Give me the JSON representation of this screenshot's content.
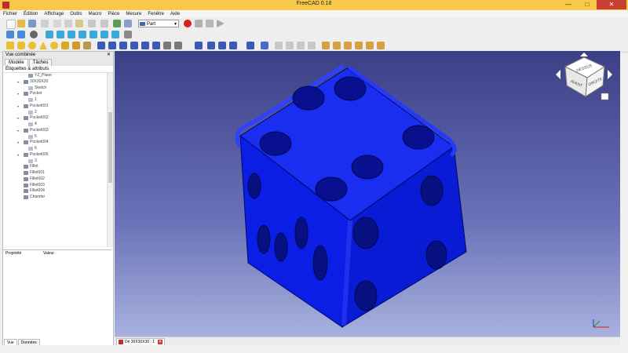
{
  "window": {
    "title": "FreeCAD 0.18",
    "min": "—",
    "max": "□",
    "close": "✕"
  },
  "menu": [
    "Fichier",
    "Édition",
    "Affichage",
    "Outils",
    "Macro",
    "Pièce",
    "Mesure",
    "Fenêtre",
    "Aide"
  ],
  "workbench": {
    "selected": "Part",
    "arrow": "▼"
  },
  "combo_view": {
    "title": "Vue combinée",
    "close": "✕",
    "tabs": [
      "Modèle",
      "Tâches"
    ],
    "tree_header": "Étiquettes & attributs",
    "tree": [
      {
        "label": "YZ_Plane",
        "level": 3,
        "icon": "plane"
      },
      {
        "label": "30X30X30",
        "level": 2,
        "icon": "body",
        "exp": "▾"
      },
      {
        "label": "Sketch",
        "level": 3,
        "icon": "sketch"
      },
      {
        "label": "Pocket",
        "level": 2,
        "icon": "feature",
        "exp": "▾"
      },
      {
        "label": "1",
        "level": 3,
        "icon": "sketch"
      },
      {
        "label": "Pocket001",
        "level": 2,
        "icon": "feature",
        "exp": "▾"
      },
      {
        "label": "2",
        "level": 3,
        "icon": "sketch"
      },
      {
        "label": "Pocket002",
        "level": 2,
        "icon": "feature",
        "exp": "▾"
      },
      {
        "label": "4",
        "level": 3,
        "icon": "sketch"
      },
      {
        "label": "Pocket003",
        "level": 2,
        "icon": "feature",
        "exp": "▾"
      },
      {
        "label": "5",
        "level": 3,
        "icon": "sketch"
      },
      {
        "label": "Pocket004",
        "level": 2,
        "icon": "feature",
        "exp": "▾"
      },
      {
        "label": "6",
        "level": 3,
        "icon": "sketch"
      },
      {
        "label": "Pocket005",
        "level": 2,
        "icon": "feature",
        "exp": "▾"
      },
      {
        "label": "3",
        "level": 3,
        "icon": "sketch"
      },
      {
        "label": "Fillet",
        "level": 2,
        "icon": "feature"
      },
      {
        "label": "Fillet001",
        "level": 2,
        "icon": "feature"
      },
      {
        "label": "Fillet002",
        "level": 2,
        "icon": "feature"
      },
      {
        "label": "Fillet003",
        "level": 2,
        "icon": "feature"
      },
      {
        "label": "Fillet004",
        "level": 2,
        "icon": "feature"
      },
      {
        "label": "Chamfer",
        "level": 2,
        "icon": "feature"
      }
    ],
    "prop_headers": [
      "Propriété",
      "Valeur"
    ],
    "bottom_tabs": [
      "Vue",
      "Données"
    ]
  },
  "nav_cube": {
    "faces": [
      "DESSUS",
      "AVANT",
      "DROITE"
    ]
  },
  "document_tab": {
    "label": "Dé 30X30X30 : 1",
    "close": "✕"
  },
  "colors": {
    "die_blue": "#0b1ee6",
    "titlebar": "#f8c848",
    "record": "#d82020"
  }
}
